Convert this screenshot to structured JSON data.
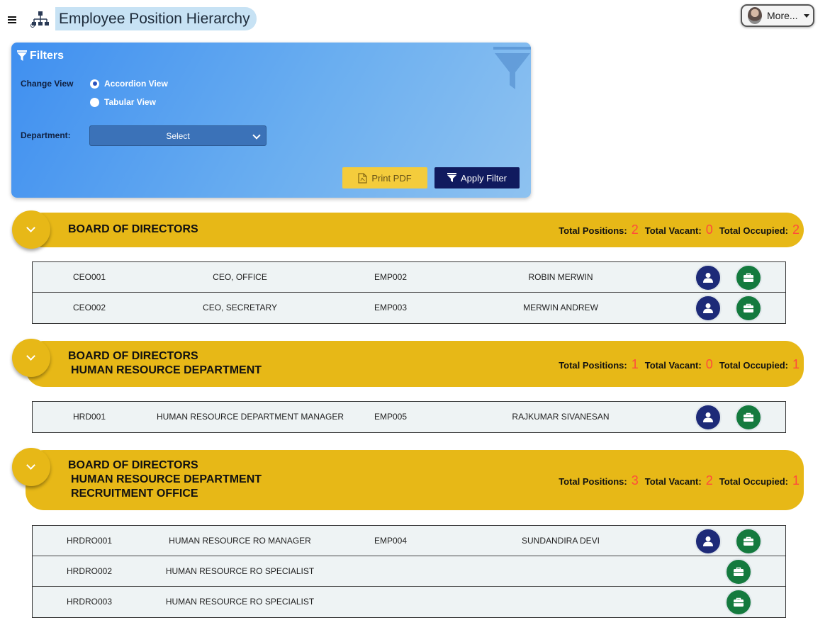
{
  "header": {
    "title": "Employee Position Hierarchy",
    "more_label": "More..."
  },
  "filters": {
    "heading": "Filters",
    "change_view_label": "Change View",
    "view_options": [
      "Accordion View",
      "Tabular View"
    ],
    "selected_view": "Accordion View",
    "department_label": "Department:",
    "department_value": "Select",
    "print_label": "Print PDF",
    "apply_label": "Apply Filter"
  },
  "stat_labels": {
    "positions": "Total Positions:",
    "vacant": "Total Vacant:",
    "occupied": "Total Occupied:"
  },
  "groups": [
    {
      "path": [
        "BOARD OF DIRECTORS"
      ],
      "total_positions": "2",
      "total_vacant": "0",
      "total_occupied": "2",
      "rows": [
        {
          "code": "CEO001",
          "position": "CEO, OFFICE",
          "emp_id": "EMP002",
          "name": "ROBIN MERWIN"
        },
        {
          "code": "CEO002",
          "position": "CEO, SECRETARY",
          "emp_id": "EMP003",
          "name": "MERWIN ANDREW"
        }
      ]
    },
    {
      "path": [
        "BOARD OF DIRECTORS",
        "HUMAN RESOURCE DEPARTMENT"
      ],
      "total_positions": "1",
      "total_vacant": "0",
      "total_occupied": "1",
      "rows": [
        {
          "code": "HRD001",
          "position": "HUMAN RESOURCE DEPARTMENT MANAGER",
          "emp_id": "EMP005",
          "name": "RAJKUMAR SIVANESAN"
        }
      ]
    },
    {
      "path": [
        "BOARD OF DIRECTORS",
        "HUMAN RESOURCE DEPARTMENT",
        "RECRUITMENT OFFICE"
      ],
      "total_positions": "3",
      "total_vacant": "2",
      "total_occupied": "1",
      "rows": [
        {
          "code": "HRDRO001",
          "position": "HUMAN RESOURCE RO MANAGER",
          "emp_id": "EMP004",
          "name": "SUNDANDIRA DEVI"
        },
        {
          "code": "HRDRO002",
          "position": "HUMAN RESOURCE RO SPECIALIST",
          "emp_id": "",
          "name": ""
        },
        {
          "code": "HRDRO003",
          "position": "HUMAN RESOURCE RO SPECIALIST",
          "emp_id": "",
          "name": ""
        }
      ]
    }
  ],
  "icons": {
    "menu": "hamburger-menu-icon",
    "app": "org-chart-icon",
    "filter": "funnel-icon",
    "pdf": "pdf-file-icon",
    "expand": "chevron-down-icon",
    "employee": "person-icon",
    "position": "briefcase-icon"
  },
  "colors": {
    "group_header": "#e7b817",
    "stat_number": "#ff4a3d",
    "employee_button": "#1d2a78",
    "position_button": "#147a3e",
    "apply_button": "#101a5e",
    "print_button": "#f4cc3c"
  }
}
